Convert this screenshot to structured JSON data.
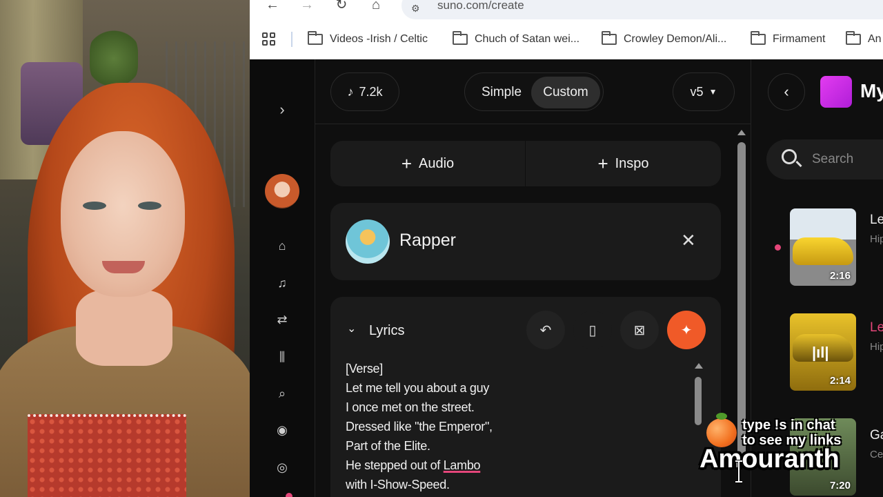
{
  "browser": {
    "url": "suno.com/create",
    "bookmarks": [
      "Videos -Irish / Celtic",
      "Chuch of Satan wei...",
      "Crowley Demon/Ali...",
      "Firmament",
      "An"
    ]
  },
  "topbar": {
    "credits": "7.2k",
    "mode_simple": "Simple",
    "mode_custom": "Custom",
    "version": "v5"
  },
  "create": {
    "audio_label": "Audio",
    "inspo_label": "Inspo",
    "persona_name": "Rapper",
    "lyrics_label": "Lyrics",
    "lyrics_lines": [
      "[Verse]",
      "Let me tell you about a guy",
      "I once met on the street.",
      "Dressed like \"the Emperor\",",
      "Part of the Elite."
    ],
    "lyrics_line6_prefix": "He stepped out of ",
    "lyrics_line6_word": "Lambo",
    "lyrics_line7": "with I-Show-Speed."
  },
  "workspace": {
    "title": "My",
    "search_placeholder": "Search",
    "songs": [
      {
        "title": "Le",
        "sub": "Hip",
        "duration": "2:16"
      },
      {
        "title": "Le",
        "sub": "Hip",
        "duration": "2:14"
      },
      {
        "title": "Ga",
        "sub": "Ce",
        "duration": "7:20"
      }
    ]
  },
  "overlay": {
    "line1": "type !s in chat",
    "line2": "to see my links",
    "name": "Amouranth"
  },
  "colors": {
    "accent": "#e5467a",
    "magic_button": "#f05a28",
    "workspace_thumb": "#d62ef0"
  }
}
